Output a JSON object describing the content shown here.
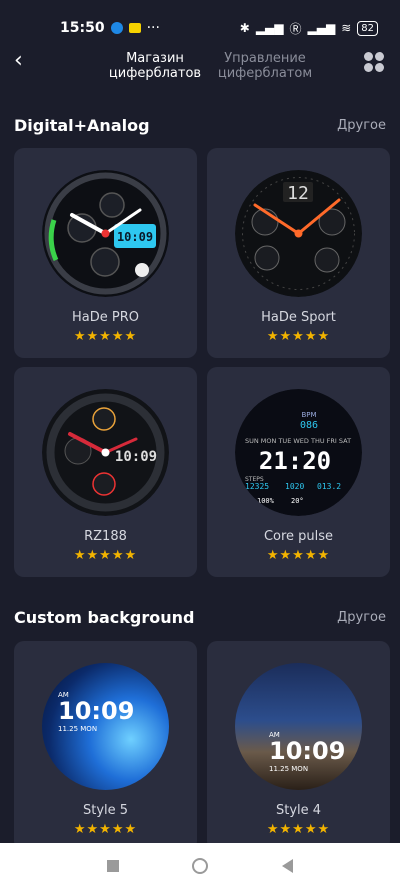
{
  "status": {
    "time": "15:50",
    "dots": "···",
    "battery": "82"
  },
  "nav": {
    "tab_store": "Магазин циферблатов",
    "tab_manage": "Управление циферблатом"
  },
  "sections": [
    {
      "title": "Digital+Analog",
      "more": "Другое",
      "items": [
        {
          "name": "HaDe PRO",
          "stars": "★★★★★",
          "time": "10:09"
        },
        {
          "name": "HaDe Sport",
          "stars": "★★★★★",
          "time": "12"
        },
        {
          "name": "RZ188",
          "stars": "★★★★★",
          "time": "10:09"
        },
        {
          "name": "Core pulse",
          "stars": "★★★★★",
          "time": "21:20",
          "steps": "12325",
          "kcal": "1020",
          "dist": "013.2",
          "bpm": "086",
          "power": "100%",
          "temp": "20°"
        }
      ]
    },
    {
      "title": "Custom background",
      "more": "Другое",
      "items": [
        {
          "name": "Style 5",
          "stars": "★★★★★",
          "time": "10:09",
          "ampm": "AM",
          "date": "11.25 MON"
        },
        {
          "name": "Style 4",
          "stars": "★★★★★",
          "time": "10:09",
          "ampm": "AM",
          "date": "11.25 MON"
        }
      ]
    }
  ],
  "colors": {
    "background": "#1b1d2b",
    "card": "#2a2d3e",
    "star": "#f3b400",
    "accent_orange": "#ff6a2a",
    "accent_cyan": "#2ec8f0"
  }
}
